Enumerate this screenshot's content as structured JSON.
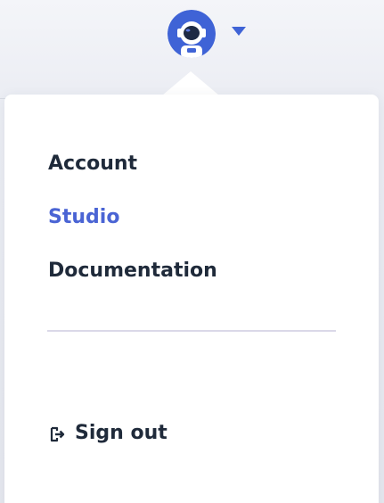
{
  "header": {
    "avatar_icon": "astronaut-avatar-icon",
    "menu_toggle_icon": "chevron-down-icon"
  },
  "menu": {
    "items": [
      {
        "label": "Account",
        "active": false
      },
      {
        "label": "Studio",
        "active": true
      },
      {
        "label": "Documentation",
        "active": false
      }
    ],
    "sign_out": {
      "label": "Sign out",
      "icon": "sign-out-icon"
    }
  },
  "colors": {
    "accent": "#4a64d4",
    "text": "#1f2a3a",
    "divider": "#dad8e8"
  }
}
